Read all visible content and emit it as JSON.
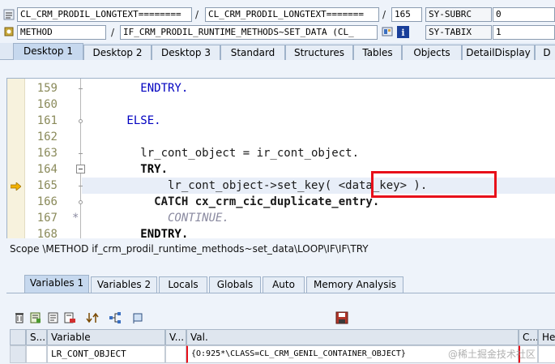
{
  "header": {
    "row1": {
      "field1": "CL_CRM_PRODIL_LONGTEXT========",
      "sep1": "/",
      "field2": "CL_CRM_PRODIL_LONGTEXT=======",
      "sep2": "/",
      "line_no": "165",
      "var_name": "SY-SUBRC",
      "var_value": "0"
    },
    "row2": {
      "type": "METHOD",
      "sep1": "/",
      "method": "IF_CRM_PRODIL_RUNTIME_METHODS~SET_DATA (CL_",
      "var_name": "SY-TABIX",
      "var_value": "1"
    }
  },
  "tabs": [
    {
      "label": "Desktop 1",
      "active": true
    },
    {
      "label": "Desktop 2"
    },
    {
      "label": "Desktop 3"
    },
    {
      "label": "Standard"
    },
    {
      "label": "Structures"
    },
    {
      "label": "Tables"
    },
    {
      "label": "Objects"
    },
    {
      "label": "DetailDisplay"
    },
    {
      "label": "D"
    }
  ],
  "editor": {
    "lines": [
      {
        "no": "159",
        "code": "          ENDTRY."
      },
      {
        "no": "160",
        "code": ""
      },
      {
        "no": "161",
        "code": "        ELSE."
      },
      {
        "no": "162",
        "code": ""
      },
      {
        "no": "163",
        "code": "          lr_cont_object = ir_cont_object."
      },
      {
        "no": "164",
        "code": "          TRY."
      },
      {
        "no": "165",
        "code": "              lr_cont_object->set_key( <data_key> )."
      },
      {
        "no": "166",
        "code": "            CATCH cx_crm_cic_duplicate_entry."
      },
      {
        "no": "167",
        "code": "*             CONTINUE."
      },
      {
        "no": "168",
        "code": "          ENDTRY."
      }
    ],
    "current_line": "165",
    "highlight_text": "<data_key> )."
  },
  "scope": "Scope \\METHOD if_crm_prodil_runtime_methods~set_data\\LOOP\\IF\\IF\\TRY",
  "var_tabs": [
    {
      "label": "Variables 1",
      "active": true
    },
    {
      "label": "Variables 2"
    },
    {
      "label": "Locals"
    },
    {
      "label": "Globals"
    },
    {
      "label": "Auto"
    },
    {
      "label": "Memory Analysis"
    }
  ],
  "grid": {
    "headers": {
      "s": "S...",
      "variable": "Variable",
      "v": "V...",
      "val": "Val.",
      "c": "C...",
      "hex": "Hex"
    },
    "row": {
      "variable": "LR_CONT_OBJECT",
      "val": "{O:925*\\CLASS=CL_CRM_GENIL_CONTAINER_OBJECT}"
    }
  },
  "watermark": "@稀土掘金技术社区",
  "colors": {
    "highlight_box": "#e8101a",
    "active_tab": "#c6d8ee",
    "keyword": "#0000c0"
  }
}
